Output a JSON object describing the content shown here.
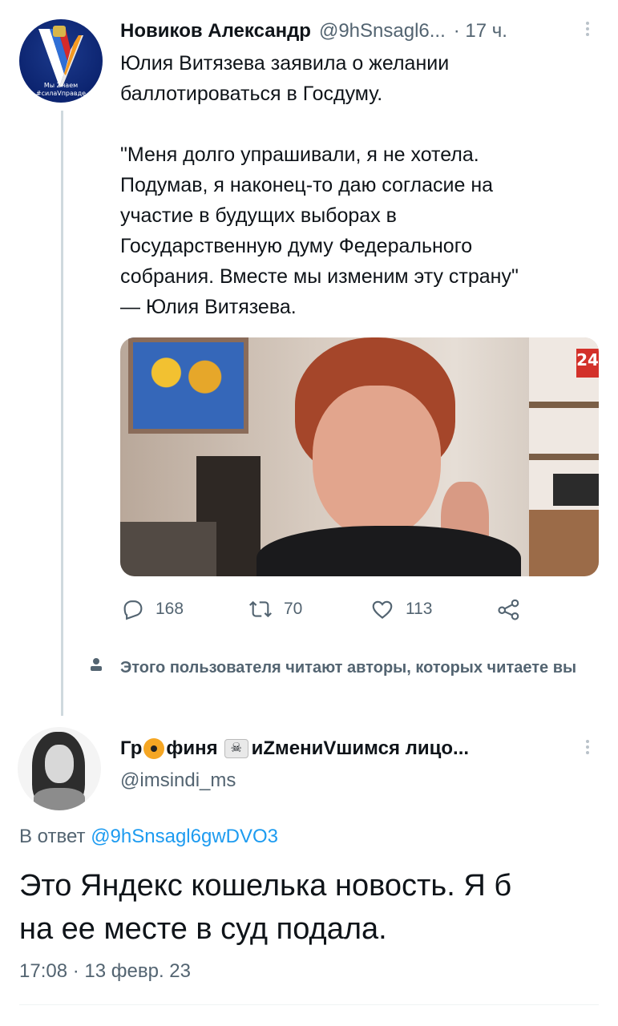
{
  "tweet1": {
    "author_name": "Новиков Александр",
    "author_handle": "@9hSnsagl6...",
    "time": "· 17 ч.",
    "avatar_caption_line1": "Мы Zнаем",
    "avatar_caption_line2": "#силаVправде",
    "text_lines_1": [
      "Юлия Витязева заявила о желании",
      "баллотироваться в Госдуму."
    ],
    "text_lines_2": [
      "\"Меня долго упрашивали, я не хотела.",
      "Подумав, я наконец-то даю согласие на",
      "участие в будущих выборах в",
      "Государственную думу Федерального",
      "собрания. Вместе мы изменим эту страну\"",
      "— Юлия Витязева."
    ],
    "media_badge": "24",
    "actions": {
      "replies": "168",
      "retweets": "70",
      "likes": "113"
    }
  },
  "followed_by": {
    "text": "Этого пользователя читают авторы, которых читаете вы"
  },
  "tweet2": {
    "name_part1": "Гр",
    "name_part2": "финя",
    "name_part3": "иZмениVшимся лицо...",
    "author_handle": "@imsindi_ms",
    "reply_prefix": "В ответ",
    "reply_mention": "@9hSnsagl6gwDVO3",
    "text_lines": [
      "Это Яндекс кошелька новость. Я б",
      "на ее месте в суд подала."
    ],
    "date": "17:08 · 13 февр. 23"
  },
  "colors": {
    "text": "#0f1419",
    "secondary": "#536471",
    "link": "#1d9bf0",
    "thread_line": "#cfd9de"
  },
  "icons": [
    "reply-icon",
    "retweet-icon",
    "like-icon",
    "share-icon",
    "more-icon",
    "person-icon"
  ]
}
